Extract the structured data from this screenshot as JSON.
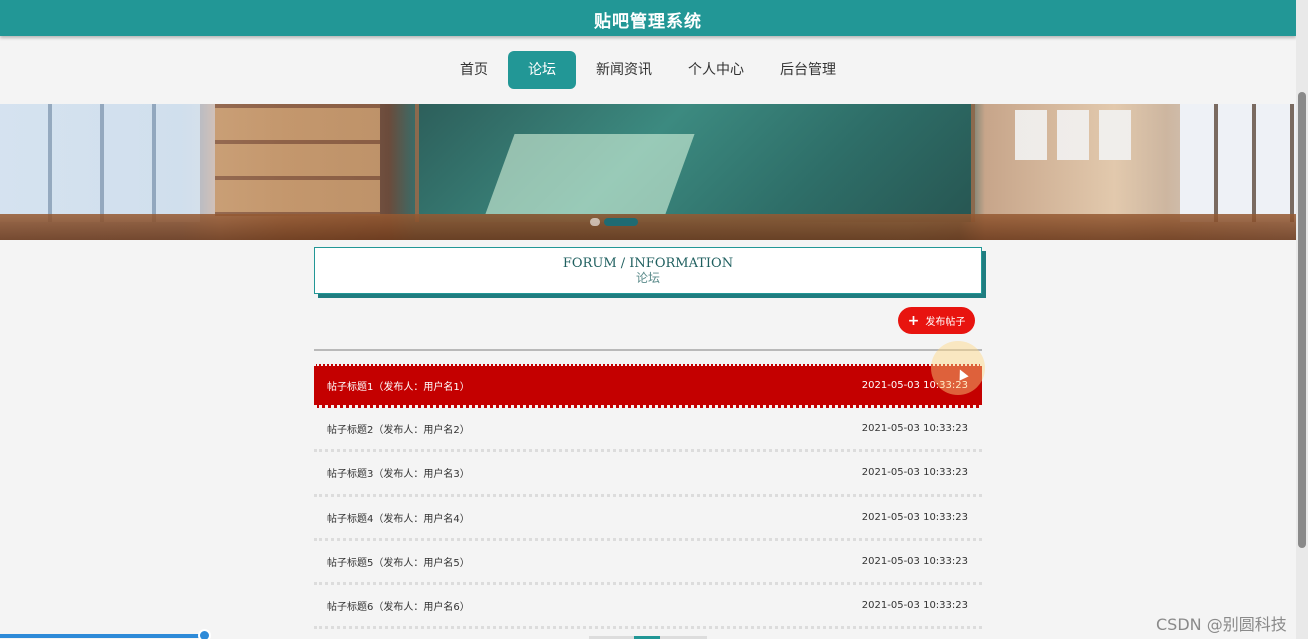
{
  "app": {
    "title": "贴吧管理系统"
  },
  "nav": {
    "items": [
      {
        "label": "首页",
        "active": false
      },
      {
        "label": "论坛",
        "active": true
      },
      {
        "label": "新闻资讯",
        "active": false
      },
      {
        "label": "个人中心",
        "active": false
      },
      {
        "label": "后台管理",
        "active": false
      }
    ]
  },
  "banner": {
    "slides": 2,
    "active_slide": 2
  },
  "section": {
    "title_en": "FORUM / INFORMATION",
    "title_cn": "论坛"
  },
  "actions": {
    "post_button": "发布帖子"
  },
  "posts": [
    {
      "title": "帖子标题1（发布人：用户名1）",
      "time": "2021-05-03 10:33:23",
      "highlighted": true
    },
    {
      "title": "帖子标题2（发布人：用户名2）",
      "time": "2021-05-03 10:33:23",
      "highlighted": false
    },
    {
      "title": "帖子标题3（发布人：用户名3）",
      "time": "2021-05-03 10:33:23",
      "highlighted": false
    },
    {
      "title": "帖子标题4（发布人：用户名4）",
      "time": "2021-05-03 10:33:23",
      "highlighted": false
    },
    {
      "title": "帖子标题5（发布人：用户名5）",
      "time": "2021-05-03 10:33:23",
      "highlighted": false
    },
    {
      "title": "帖子标题6（发布人：用户名6）",
      "time": "2021-05-03 10:33:23",
      "highlighted": false
    }
  ],
  "colors": {
    "primary": "#229796",
    "accent_red": "#c40000",
    "button_red": "#e8140f"
  },
  "watermark": "CSDN @别圆科技"
}
